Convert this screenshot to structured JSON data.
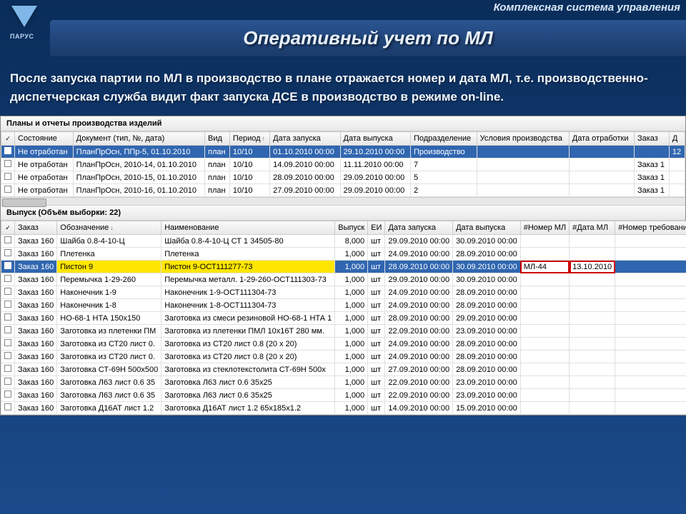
{
  "header": {
    "subtitle": "Комплексная система управления",
    "logo_text": "ПАРУС",
    "title": "Оперативный учет по МЛ"
  },
  "description": "После запуска партии по МЛ в производство в плане отражается номер и дата МЛ, т.е. производственно-диспетчерская служба видит факт запуска ДСЕ в производство в режиме on-line.",
  "panel1": {
    "title": "Планы и отчеты производства изделий",
    "columns": [
      "",
      "Состояние",
      "Документ (тип, №, дата)",
      "Вид",
      "Период",
      "Дата запуска",
      "Дата выпуска",
      "Подразделение",
      "Условия производства",
      "Дата отработки",
      "Заказ",
      "Д"
    ],
    "rows": [
      {
        "sel": true,
        "state": "Не отработан",
        "doc": "ПланПрОсн, ППр-5, 01.10.2010",
        "vid": "план",
        "per": "10/10",
        "dz": "01.10.2010 00:00",
        "dv": "29.10.2010 00:00",
        "pod": "Производство",
        "usl": "",
        "dot": "",
        "zak": "",
        "d": "12"
      },
      {
        "sel": false,
        "state": "Не отработан",
        "doc": "ПланПрОсн, 2010-14, 01.10.2010",
        "vid": "план",
        "per": "10/10",
        "dz": "14.09.2010 00:00",
        "dv": "11.11.2010 00:00",
        "pod": "7",
        "usl": "",
        "dot": "",
        "zak": "Заказ 1",
        "d": ""
      },
      {
        "sel": false,
        "state": "Не отработан",
        "doc": "ПланПрОсн, 2010-15, 01.10.2010",
        "vid": "план",
        "per": "10/10",
        "dz": "28.09.2010 00:00",
        "dv": "29.09.2010 00:00",
        "pod": "5",
        "usl": "",
        "dot": "",
        "zak": "Заказ 1",
        "d": ""
      },
      {
        "sel": false,
        "state": "Не отработан",
        "doc": "ПланПрОсн, 2010-16, 01.10.2010",
        "vid": "план",
        "per": "10/10",
        "dz": "27.09.2010 00:00",
        "dv": "29.09.2010 00:00",
        "pod": "2",
        "usl": "",
        "dot": "",
        "zak": "Заказ 1",
        "d": ""
      }
    ]
  },
  "panel2": {
    "title": "Выпуск (Объём выборки: 22)",
    "columns": [
      "",
      "Заказ",
      "Обозначение",
      "Наименование",
      "Выпуск",
      "ЕИ",
      "Дата запуска",
      "Дата выпуска",
      "#Номер МЛ",
      "#Дата МЛ",
      "#Номер требования"
    ],
    "rows": [
      {
        "hl": "",
        "zak": "Заказ 160",
        "ob": "Шайба 0.8-4-10-Ц",
        "nm": "Шайба 0.8-4-10-Ц СТ 1 34505-80",
        "vy": "8,000",
        "ei": "шт",
        "dz": "29.09.2010 00:00",
        "dv": "30.09.2010 00:00",
        "ml": "",
        "mld": "",
        "tr": ""
      },
      {
        "hl": "",
        "zak": "Заказ 160",
        "ob": "Плетенка",
        "nm": "Плетенка",
        "vy": "1,000",
        "ei": "шт",
        "dz": "24.09.2010 00:00",
        "dv": "28.09.2010 00:00",
        "ml": "",
        "mld": "",
        "tr": ""
      },
      {
        "hl": "sel",
        "zak": "Заказ 160",
        "ob": "Пистон 9",
        "nm": "Пистон 9-ОСТ111277-73",
        "vy": "1,000",
        "ei": "шт",
        "dz": "28.09.2010 00:00",
        "dv": "30.09.2010 00:00",
        "ml": "МЛ-44",
        "mld": "13.10.2010",
        "tr": ""
      },
      {
        "hl": "",
        "zak": "Заказ 160",
        "ob": "Перемычка 1-29-260",
        "nm": "Перемычка металл. 1-29-260-ОСТ111303-73",
        "vy": "1,000",
        "ei": "шт",
        "dz": "29.09.2010 00:00",
        "dv": "30.09.2010 00:00",
        "ml": "",
        "mld": "",
        "tr": ""
      },
      {
        "hl": "",
        "zak": "Заказ 160",
        "ob": "Наконечник 1-9",
        "nm": "Наконечник 1-9-ОСТ111304-73",
        "vy": "1,000",
        "ei": "шт",
        "dz": "24.09.2010 00:00",
        "dv": "28.09.2010 00:00",
        "ml": "",
        "mld": "",
        "tr": ""
      },
      {
        "hl": "",
        "zak": "Заказ 160",
        "ob": "Наконечник 1-8",
        "nm": "Наконечник 1-8-ОСТ111304-73",
        "vy": "1,000",
        "ei": "шт",
        "dz": "24.09.2010 00:00",
        "dv": "28.09.2010 00:00",
        "ml": "",
        "mld": "",
        "tr": ""
      },
      {
        "hl": "",
        "zak": "Заказ 160",
        "ob": "НО-68-1 НТА 150x150",
        "nm": "Заготовка из смеси резиновой НО-68-1 НТА 1",
        "vy": "1,000",
        "ei": "шт",
        "dz": "28.09.2010 00:00",
        "dv": "29.09.2010 00:00",
        "ml": "",
        "mld": "",
        "tr": ""
      },
      {
        "hl": "",
        "zak": "Заказ 160",
        "ob": "Заготовка из плетенки ПМ",
        "nm": "Заготовка из плетенки ПМЛ 10x16Т 280 мм.",
        "vy": "1,000",
        "ei": "шт",
        "dz": "22.09.2010 00:00",
        "dv": "23.09.2010 00:00",
        "ml": "",
        "mld": "",
        "tr": ""
      },
      {
        "hl": "",
        "zak": "Заказ 160",
        "ob": "Заготовка из СТ20 лист 0.",
        "nm": "Заготовка из СТ20 лист 0.8 (20 x 20)",
        "vy": "1,000",
        "ei": "шт",
        "dz": "24.09.2010 00:00",
        "dv": "28.09.2010 00:00",
        "ml": "",
        "mld": "",
        "tr": ""
      },
      {
        "hl": "",
        "zak": "Заказ 160",
        "ob": "Заготовка из СТ20 лист 0.",
        "nm": "Заготовка из СТ20 лист 0.8 (20 x 20)",
        "vy": "1,000",
        "ei": "шт",
        "dz": "24.09.2010 00:00",
        "dv": "28.09.2010 00:00",
        "ml": "",
        "mld": "",
        "tr": ""
      },
      {
        "hl": "",
        "zak": "Заказ 160",
        "ob": "Заготовка СТ-69Н 500x500",
        "nm": "Заготовка из стеклотекстолита СТ-69Н 500x",
        "vy": "1,000",
        "ei": "шт",
        "dz": "27.09.2010 00:00",
        "dv": "28.09.2010 00:00",
        "ml": "",
        "mld": "",
        "tr": ""
      },
      {
        "hl": "",
        "zak": "Заказ 160",
        "ob": "Заготовка Л63 лист 0.6 35",
        "nm": "Заготовка Л63 лист 0.6 35x25",
        "vy": "1,000",
        "ei": "шт",
        "dz": "22.09.2010 00:00",
        "dv": "23.09.2010 00:00",
        "ml": "",
        "mld": "",
        "tr": ""
      },
      {
        "hl": "",
        "zak": "Заказ 160",
        "ob": "Заготовка Л63 лист 0.6 35",
        "nm": "Заготовка Л63 лист 0.6 35x25",
        "vy": "1,000",
        "ei": "шт",
        "dz": "22.09.2010 00:00",
        "dv": "23.09.2010 00:00",
        "ml": "",
        "mld": "",
        "tr": ""
      },
      {
        "hl": "",
        "zak": "Заказ 160",
        "ob": "Заготовка Д16АТ лист 1.2",
        "nm": "Заготовка Д16АТ лист 1.2 65x185x1.2",
        "vy": "1,000",
        "ei": "шт",
        "dz": "14.09.2010 00:00",
        "dv": "15.09.2010 00:00",
        "ml": "",
        "mld": "",
        "tr": ""
      }
    ]
  }
}
